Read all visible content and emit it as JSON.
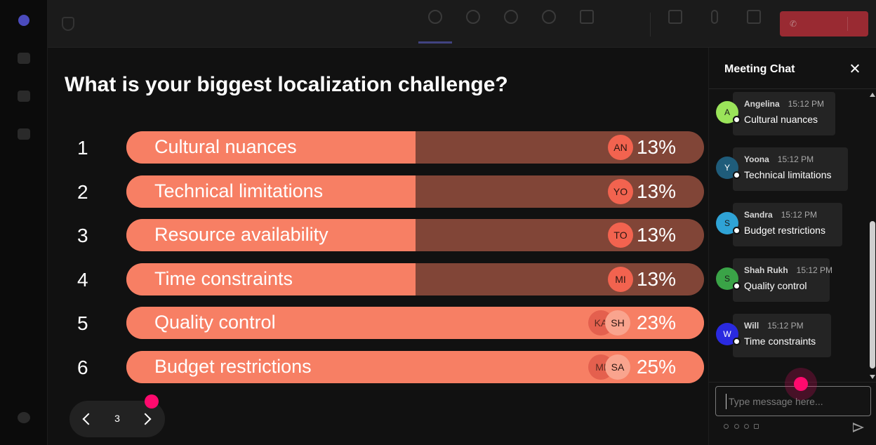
{
  "poll": {
    "question": "What is your biggest localization challenge?",
    "options": [
      {
        "number": "1",
        "label": "Cultural nuances",
        "percent": "13%",
        "fill_fraction": 0.5,
        "avatars": [
          "AN"
        ]
      },
      {
        "number": "2",
        "label": "Technical limitations",
        "percent": "13%",
        "fill_fraction": 0.5,
        "avatars": [
          "YO"
        ]
      },
      {
        "number": "3",
        "label": "Resource availability",
        "percent": "13%",
        "fill_fraction": 0.5,
        "avatars": [
          "TO"
        ]
      },
      {
        "number": "4",
        "label": "Time constraints",
        "percent": "13%",
        "fill_fraction": 0.5,
        "avatars": [
          "MI"
        ]
      },
      {
        "number": "5",
        "label": "Quality control",
        "percent": "23%",
        "fill_fraction": 1.0,
        "avatars": [
          "KA",
          "SH"
        ]
      },
      {
        "number": "6",
        "label": "Budget restrictions",
        "percent": "25%",
        "fill_fraction": 1.0,
        "avatars": [
          "MI",
          "SA"
        ]
      }
    ],
    "colors": {
      "fill": "#f77f64",
      "remainder": "#814537"
    }
  },
  "pager": {
    "current_page": "3"
  },
  "chat": {
    "title": "Meeting Chat",
    "messages": [
      {
        "initial": "A",
        "author": "Angelina",
        "time": "15:12 PM",
        "text": "Cultural nuances",
        "avatar_color": "#9be45a"
      },
      {
        "initial": "Y",
        "author": "Yoona",
        "time": "15:12 PM",
        "text": "Technical limitations",
        "avatar_color": "#1f5c7a"
      },
      {
        "initial": "S",
        "author": "Sandra",
        "time": "15:12 PM",
        "text": "Budget restrictions",
        "avatar_color": "#2fa3d6"
      },
      {
        "initial": "S",
        "author": "Shah Rukh",
        "time": "15:12 PM",
        "text": "Quality control",
        "avatar_color": "#3aa347"
      },
      {
        "initial": "W",
        "author": "Will",
        "time": "15:12 PM",
        "text": "Time constraints",
        "avatar_color": "#2a2ae0"
      }
    ],
    "compose_placeholder": "Type message here..."
  },
  "icons": {
    "close": "close-icon",
    "send": "send-icon",
    "prev": "chevron-left-icon",
    "next": "chevron-right-icon"
  }
}
